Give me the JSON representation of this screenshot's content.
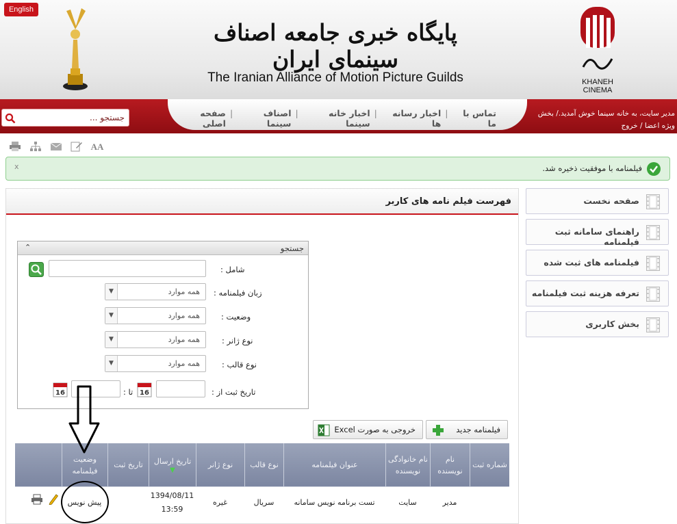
{
  "header": {
    "lang_button": "English",
    "title_fa": "پایگاه خبری جامعه اصناف سینمای ایران",
    "title_en": "The Iranian Alliance of Motion Picture Guilds",
    "logo_text": [
      "KHANEH",
      "CINEMA"
    ]
  },
  "nav": {
    "items": [
      "صفحه اصلی",
      "اصناف سینما",
      "اخبار خانه سینما",
      "اخبار رسانه ها",
      "تماس با ما"
    ],
    "search_placeholder": "جستجو ...",
    "welcome_line1": "مدیر سایت، به خانه سینما خوش آمدید./ بخش",
    "welcome_line2": "ویژه اعضا / خروج"
  },
  "toolbar": {
    "icons": [
      "print-icon",
      "sitemap-icon",
      "email-icon",
      "edit-icon",
      "font-size-icon"
    ],
    "font_label": "AA"
  },
  "alert": {
    "close": "x",
    "message": "فیلمنامه با موفقیت ذخیره شد."
  },
  "sidebar": {
    "items": [
      "صفحه نخست",
      "راهنمای سامانه ثبت فیلمنامه",
      "فیلمنامه های ثبت شده",
      "تعرفه هزینه ثبت فیلمنامه",
      "بخش کاربری"
    ]
  },
  "main": {
    "title": "فهرست فیلم نامه های کاربر"
  },
  "search": {
    "title": "جستجو",
    "contains_label": "شامل",
    "fields": [
      {
        "label": "زبان فیلمنامه",
        "value": "همه موارد"
      },
      {
        "label": "وضعیت",
        "value": "همه موارد"
      },
      {
        "label": "نوع ژانر",
        "value": "همه موارد"
      },
      {
        "label": "نوع قالب",
        "value": "همه موارد"
      }
    ],
    "date_from_label": "تاریخ ثبت از",
    "date_to_label": "تا",
    "calendar_day": "16"
  },
  "buttons": {
    "new_screenplay": "فیلمنامه جدید",
    "excel_export": "خروجی به صورت Excel"
  },
  "table": {
    "headers": [
      "شماره ثبت",
      "نام نویسنده",
      "نام خانوادگی نویسنده",
      "عنوان فیلمنامه",
      "نوع قالب",
      "نوع ژانر",
      "تاریخ ارسال",
      "تاریخ ثبت",
      "وضعیت فیلمنامه",
      ""
    ],
    "rows": [
      {
        "reg_no": "",
        "author_first": "مدیر",
        "author_last": "سایت",
        "title": "تست برنامه نویس سامانه",
        "format": "سریال",
        "genre": "غیره",
        "sent_date": "1394/08/11",
        "sent_time": "13:59",
        "reg_date": "",
        "status": "پیش نویس"
      }
    ]
  },
  "colors": {
    "brand_red": "#c8141b",
    "alert_green": "#dff2df",
    "table_header": "#8a93ad"
  }
}
